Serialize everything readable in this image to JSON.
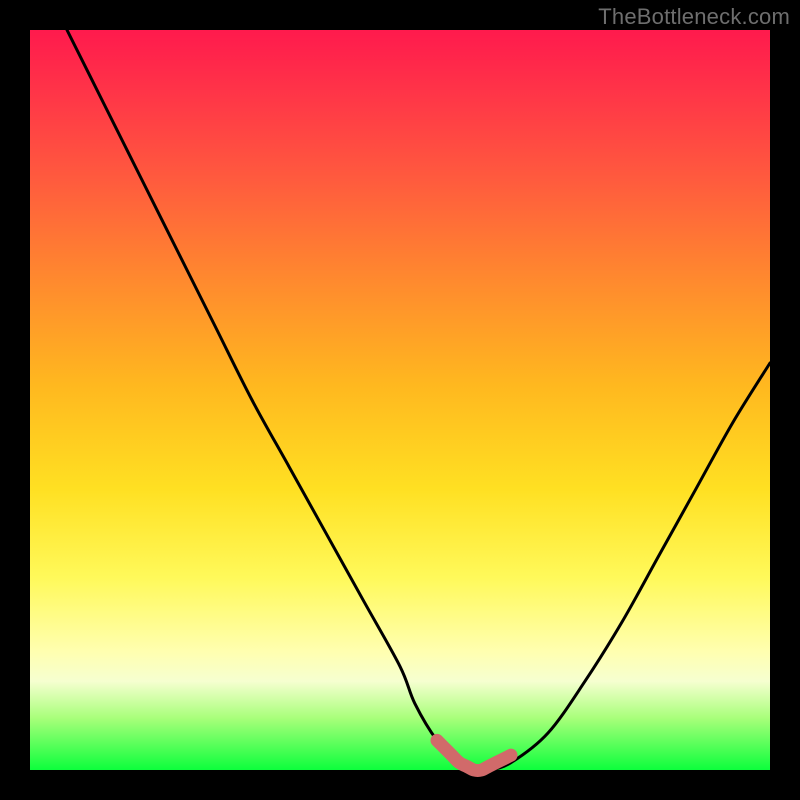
{
  "watermark": "TheBottleneck.com",
  "colors": {
    "curve_stroke": "#000000",
    "marker_stroke": "#d16a6a",
    "gradient_top": "#ff1a4d",
    "gradient_bottom": "#0cff3c",
    "frame": "#000000"
  },
  "chart_data": {
    "type": "line",
    "title": "",
    "xlabel": "",
    "ylabel": "",
    "xlim": [
      0,
      100
    ],
    "ylim": [
      0,
      100
    ],
    "grid": false,
    "legend": false,
    "series": [
      {
        "name": "bottleneck-curve",
        "x": [
          5,
          10,
          15,
          20,
          25,
          30,
          35,
          40,
          45,
          50,
          52,
          55,
          58,
          60,
          62,
          65,
          70,
          75,
          80,
          85,
          90,
          95,
          100
        ],
        "y": [
          100,
          90,
          80,
          70,
          60,
          50,
          41,
          32,
          23,
          14,
          9,
          4,
          1,
          0,
          0,
          1,
          5,
          12,
          20,
          29,
          38,
          47,
          55
        ]
      }
    ],
    "highlight": {
      "name": "optimal-range",
      "x": [
        55,
        56,
        57,
        58,
        59,
        60,
        61,
        62,
        63,
        64,
        65
      ],
      "y": [
        4,
        3,
        2,
        1,
        0.5,
        0,
        0,
        0.5,
        1,
        1.5,
        2
      ]
    }
  }
}
